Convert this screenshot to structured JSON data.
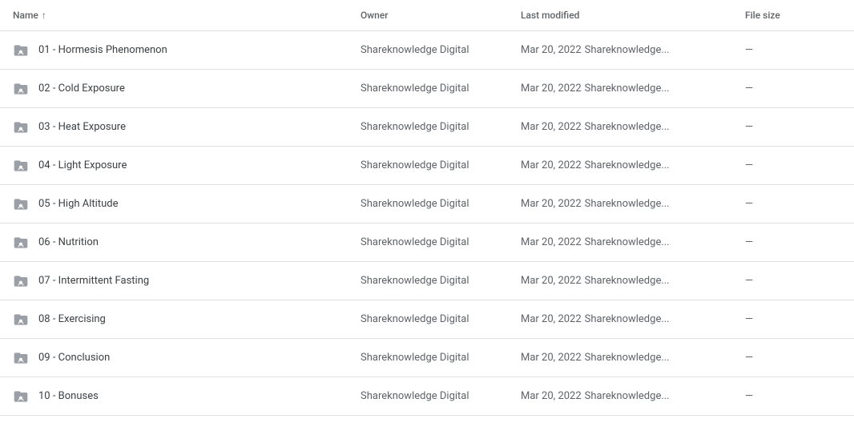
{
  "header": {
    "name_label": "Name",
    "owner_label": "Owner",
    "modified_label": "Last modified",
    "filesize_label": "File size",
    "sort_arrow": "↑"
  },
  "rows": [
    {
      "name": "01 - Hormesis Phenomenon",
      "owner": "Shareknowledge Digital",
      "modified_date": "Mar 20, 2022",
      "modified_by": "Shareknowledge...",
      "filesize": "—"
    },
    {
      "name": "02 - Cold Exposure",
      "owner": "Shareknowledge Digital",
      "modified_date": "Mar 20, 2022",
      "modified_by": "Shareknowledge...",
      "filesize": "—"
    },
    {
      "name": "03 - Heat Exposure",
      "owner": "Shareknowledge Digital",
      "modified_date": "Mar 20, 2022",
      "modified_by": "Shareknowledge...",
      "filesize": "—"
    },
    {
      "name": "04 - Light Exposure",
      "owner": "Shareknowledge Digital",
      "modified_date": "Mar 20, 2022",
      "modified_by": "Shareknowledge...",
      "filesize": "—"
    },
    {
      "name": "05 - High Altitude",
      "owner": "Shareknowledge Digital",
      "modified_date": "Mar 20, 2022",
      "modified_by": "Shareknowledge...",
      "filesize": "—"
    },
    {
      "name": "06 - Nutrition",
      "owner": "Shareknowledge Digital",
      "modified_date": "Mar 20, 2022",
      "modified_by": "Shareknowledge...",
      "filesize": "—"
    },
    {
      "name": "07 - Intermittent Fasting",
      "owner": "Shareknowledge Digital",
      "modified_date": "Mar 20, 2022",
      "modified_by": "Shareknowledge...",
      "filesize": "—"
    },
    {
      "name": "08 - Exercising",
      "owner": "Shareknowledge Digital",
      "modified_date": "Mar 20, 2022",
      "modified_by": "Shareknowledge...",
      "filesize": "—"
    },
    {
      "name": "09 - Conclusion",
      "owner": "Shareknowledge Digital",
      "modified_date": "Mar 20, 2022",
      "modified_by": "Shareknowledge...",
      "filesize": "—"
    },
    {
      "name": "10 - Bonuses",
      "owner": "Shareknowledge Digital",
      "modified_date": "Mar 20, 2022",
      "modified_by": "Shareknowledge...",
      "filesize": "—"
    }
  ]
}
